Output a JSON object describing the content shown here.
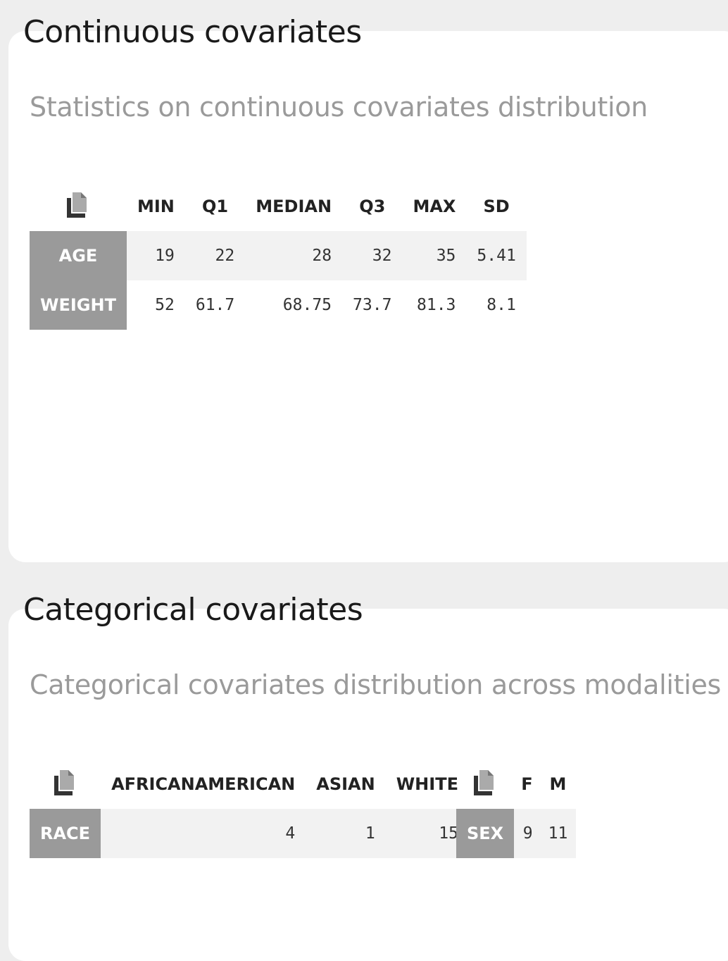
{
  "continuous": {
    "title": "Continuous covariates",
    "subtitle": "Statistics on continuous covariates distribution",
    "columns": [
      "MIN",
      "Q1",
      "MEDIAN",
      "Q3",
      "MAX",
      "SD"
    ],
    "rows": [
      {
        "label": "AGE",
        "values": [
          "19",
          "22",
          "28",
          "32",
          "35",
          "5.41"
        ]
      },
      {
        "label": "WEIGHT",
        "values": [
          "52",
          "61.7",
          "68.75",
          "73.7",
          "81.3",
          "8.1"
        ]
      }
    ],
    "copy_icon": "copy-icon"
  },
  "categorical": {
    "title": "Categorical covariates",
    "subtitle": "Categorical covariates distribution across modalities",
    "race": {
      "columns": [
        "AFRICANAMERICAN",
        "ASIAN",
        "WHITE"
      ],
      "row": {
        "label": "RACE",
        "values": [
          "4",
          "1",
          "15"
        ]
      },
      "copy_icon": "copy-icon"
    },
    "sex": {
      "columns": [
        "F",
        "M"
      ],
      "row": {
        "label": "SEX",
        "values": [
          "9",
          "11"
        ]
      },
      "copy_icon": "copy-icon"
    }
  }
}
